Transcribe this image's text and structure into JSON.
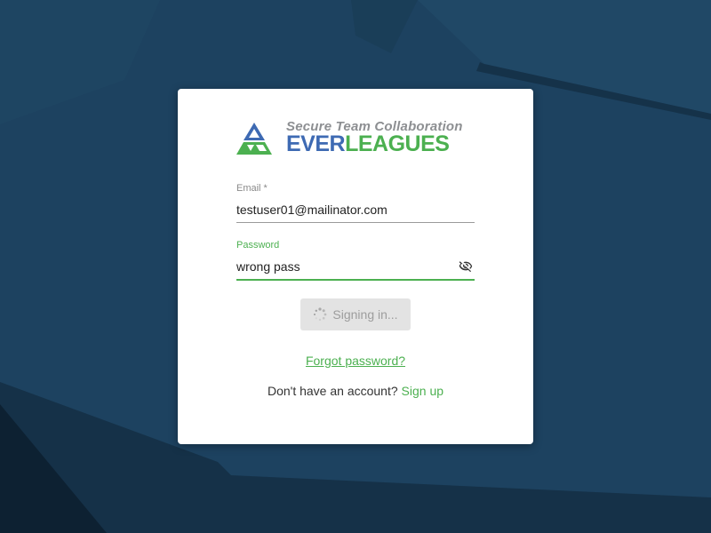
{
  "brand": {
    "tagline": "Secure Team Collaboration",
    "name_part1": "EVER",
    "name_part2": "LEAGUES",
    "color_blue": "#3e6ab3",
    "color_green": "#4cb050"
  },
  "form": {
    "email": {
      "label": "Email *",
      "value": "testuser01@mailinator.com"
    },
    "password": {
      "label": "Password",
      "value": "wrong pass",
      "toggle_icon": "eye-slash-icon"
    },
    "submit": {
      "label": "Signing in...",
      "icon": "spinner-icon",
      "state": "disabled"
    },
    "forgot_link": "Forgot password?",
    "signup_prompt": "Don't have an account?",
    "signup_link": "Sign up"
  },
  "colors": {
    "background": "#1d4260",
    "accent": "#4cb050",
    "card": "#ffffff"
  }
}
